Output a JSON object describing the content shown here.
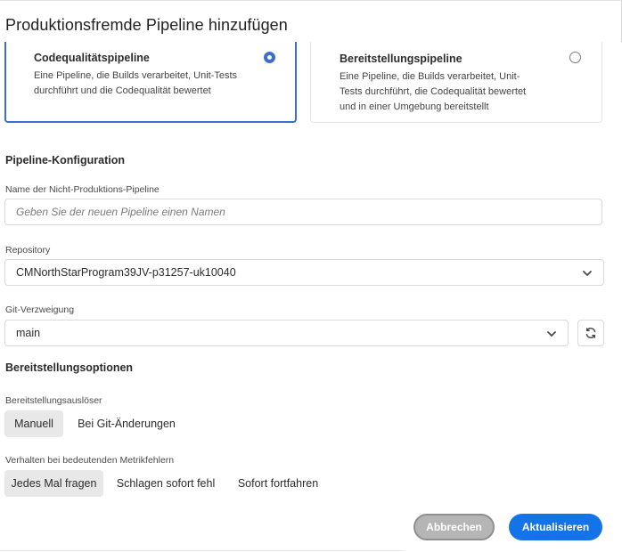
{
  "dialog": {
    "title": "Produktionsfremde Pipeline hinzufügen"
  },
  "pipeline_types": [
    {
      "title": "Codequalitätspipeline",
      "description": "Eine Pipeline, die Builds verarbeitet, Unit-Tests durchführt und die Codequalität bewertet",
      "selected": true
    },
    {
      "title": "Bereitstellungspipeline",
      "description": "Eine Pipeline, die Builds verarbeitet, Unit-Tests durchführt, die Codequalität bewertet und in einer Umgebung bereitstellt",
      "selected": false
    }
  ],
  "config": {
    "heading": "Pipeline-Konfiguration",
    "name_label": "Name der Nicht-Produktions-Pipeline",
    "name_placeholder": "Geben Sie der neuen Pipeline einen Namen",
    "name_value": "",
    "repository_label": "Repository",
    "repository_value": "CMNorthStarProgram39JV-p31257-uk10040",
    "branch_label": "Git-Verzweigung",
    "branch_value": "main"
  },
  "deployment": {
    "heading": "Bereitstellungsoptionen",
    "trigger_label": "Bereitstellungsauslöser",
    "trigger_options": [
      {
        "label": "Manuell",
        "selected": true
      },
      {
        "label": "Bei Git-Änderungen",
        "selected": false
      }
    ],
    "metric_label": "Verhalten bei bedeutenden Metrikfehlern",
    "metric_options": [
      {
        "label": "Jedes Mal fragen",
        "selected": true
      },
      {
        "label": "Schlagen sofort fehl",
        "selected": false
      },
      {
        "label": "Sofort fortfahren",
        "selected": false
      }
    ]
  },
  "actions": {
    "cancel_label": "Abbrechen",
    "submit_label": "Aktualisieren"
  },
  "colors": {
    "accent": "#1473e6",
    "selected_border": "#3b6ecd",
    "cancel_bg": "#b5b5b5",
    "segment_active_bg": "#e8e8e8"
  },
  "icons": {
    "repository_picker": "chevron-down-icon",
    "branch_picker": "chevron-down-icon",
    "refresh": "refresh-icon"
  }
}
